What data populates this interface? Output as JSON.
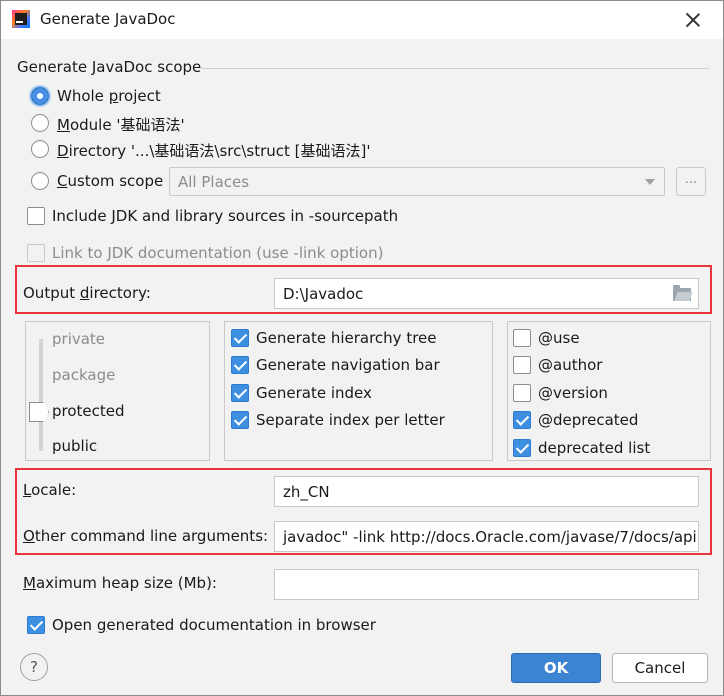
{
  "window": {
    "title": "Generate JavaDoc"
  },
  "scope": {
    "section_title": "Generate JavaDoc scope",
    "options": [
      {
        "prefix": "Whole ",
        "underline": "p",
        "suffix": "roject",
        "selected": true
      },
      {
        "prefix": "",
        "underline": "M",
        "suffix": "odule '基础语法'",
        "selected": false
      },
      {
        "prefix": "",
        "underline": "D",
        "suffix": "irectory '...\\基础语法\\src\\struct [基础语法]'",
        "selected": false
      },
      {
        "prefix": "",
        "underline": "C",
        "suffix": "ustom scope",
        "selected": false
      }
    ],
    "custom_scope_value": "All Places",
    "browse_label": "..."
  },
  "options": {
    "include_jdk": "Include JDK and library sources in -sourcepath",
    "link_jdk": "Link to JDK documentation (use -link option)"
  },
  "output": {
    "label_prefix": "Output ",
    "label_underline": "d",
    "label_suffix": "irectory:",
    "value": "D:\\Javadoc"
  },
  "visibility": {
    "levels": [
      "private",
      "package",
      "protected",
      "public"
    ],
    "selected": "protected"
  },
  "generate": [
    {
      "label": "Generate hierarchy tree",
      "checked": true
    },
    {
      "label": "Generate navigation bar",
      "checked": true
    },
    {
      "label": "Generate index",
      "checked": true
    },
    {
      "label": "Separate index per letter",
      "checked": true
    }
  ],
  "tags": [
    {
      "label": "@use",
      "checked": false
    },
    {
      "label": "@author",
      "checked": false
    },
    {
      "label": "@version",
      "checked": false
    },
    {
      "label": "@deprecated",
      "checked": true
    },
    {
      "label": "deprecated list",
      "checked": true
    }
  ],
  "locale": {
    "label_underline": "L",
    "label_suffix": "ocale:",
    "value": "zh_CN"
  },
  "args": {
    "label_underline": "O",
    "label_suffix": "ther command line arguments:",
    "value": "javadoc\" -link http://docs.Oracle.com/javase/7/docs/api"
  },
  "heap": {
    "label_underline": "M",
    "label_suffix": "aximum heap size (Mb):",
    "value": ""
  },
  "open_browser": {
    "prefix": "Open ",
    "underline": "g",
    "suffix": "enerated documentation in browser",
    "checked": true
  },
  "buttons": {
    "help": "?",
    "ok": "OK",
    "cancel": "Cancel"
  },
  "colors": {
    "accent": "#3c84d2",
    "highlight": "#e8343c"
  }
}
